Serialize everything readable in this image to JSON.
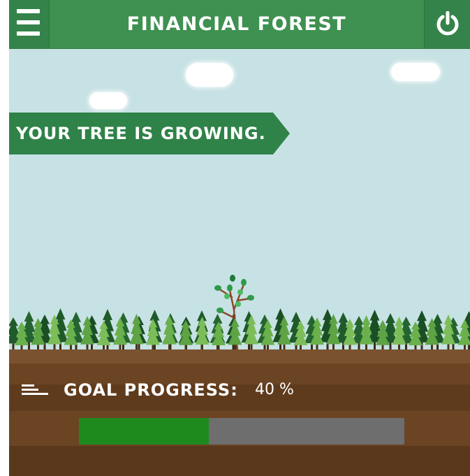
{
  "header": {
    "title": "FINANCIAL FOREST",
    "menu_icon": "hamburger-menu-icon",
    "power_icon": "power-icon"
  },
  "banner": {
    "message": "YOUR TREE IS GROWING."
  },
  "goal": {
    "label": "GOAL PROGRESS:",
    "value_text": "40 %",
    "progress_fraction": 0.4,
    "icon": "list-lines-icon"
  },
  "colors": {
    "header_green": "#3e9150",
    "sky": "#c7e2e4",
    "soil": "#6b4423",
    "progress_fill": "#1e8a1e",
    "progress_track": "#6e6e6e"
  }
}
